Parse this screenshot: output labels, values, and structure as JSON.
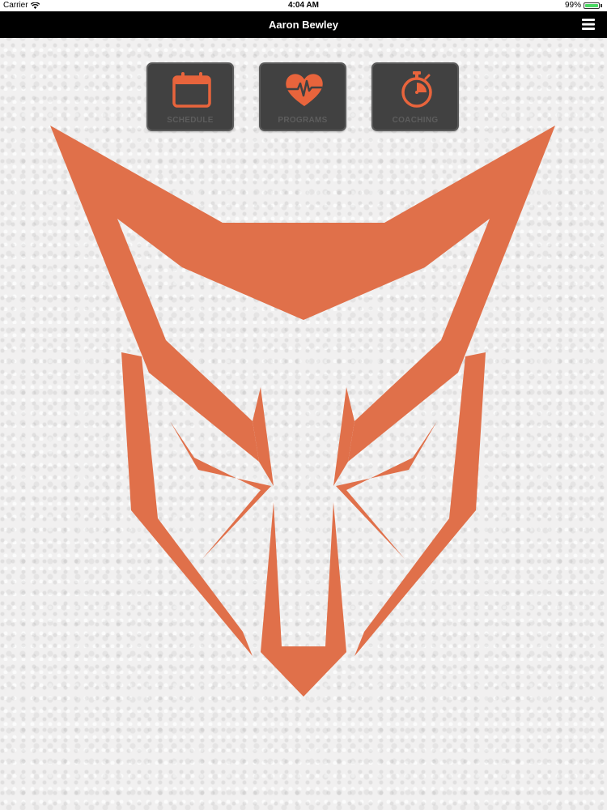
{
  "status_bar": {
    "carrier": "Carrier",
    "time": "4:04 AM",
    "battery": "99%",
    "battery_level": 0.99
  },
  "nav": {
    "title": "Aaron Bewley",
    "menu_icon": "hamburger-menu-icon"
  },
  "tiles": [
    {
      "label": "SCHEDULE",
      "icon": "calendar-icon"
    },
    {
      "label": "PROGRAMS",
      "icon": "heart-pulse-icon"
    },
    {
      "label": "COACHING",
      "icon": "stopwatch-icon"
    }
  ],
  "colors": {
    "accent": "#e8643c",
    "logo": "#e0704a",
    "tile_bg": "#414141",
    "nav_bg": "#000000"
  },
  "logo": {
    "icon": "fox-logo"
  }
}
